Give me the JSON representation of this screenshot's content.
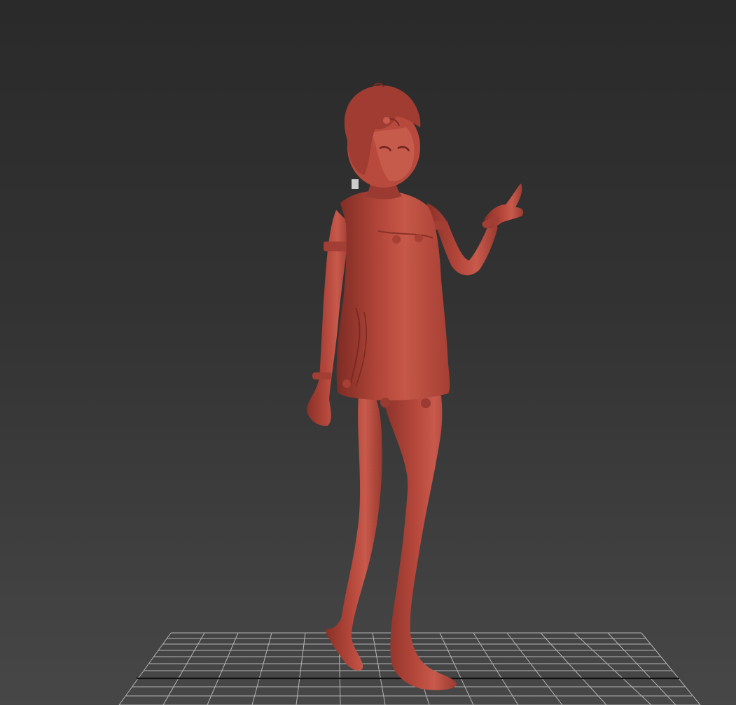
{
  "viewport": {
    "background_top": "#2a2a2a",
    "background_bottom": "#474747",
    "grid_color": "#c8c8c8",
    "grid_axis_color": "#111111",
    "model_color": "#b5473b",
    "model_shadow": "#8a3128",
    "model_highlight": "#d46a5c",
    "icon": "3d-model-icon"
  }
}
